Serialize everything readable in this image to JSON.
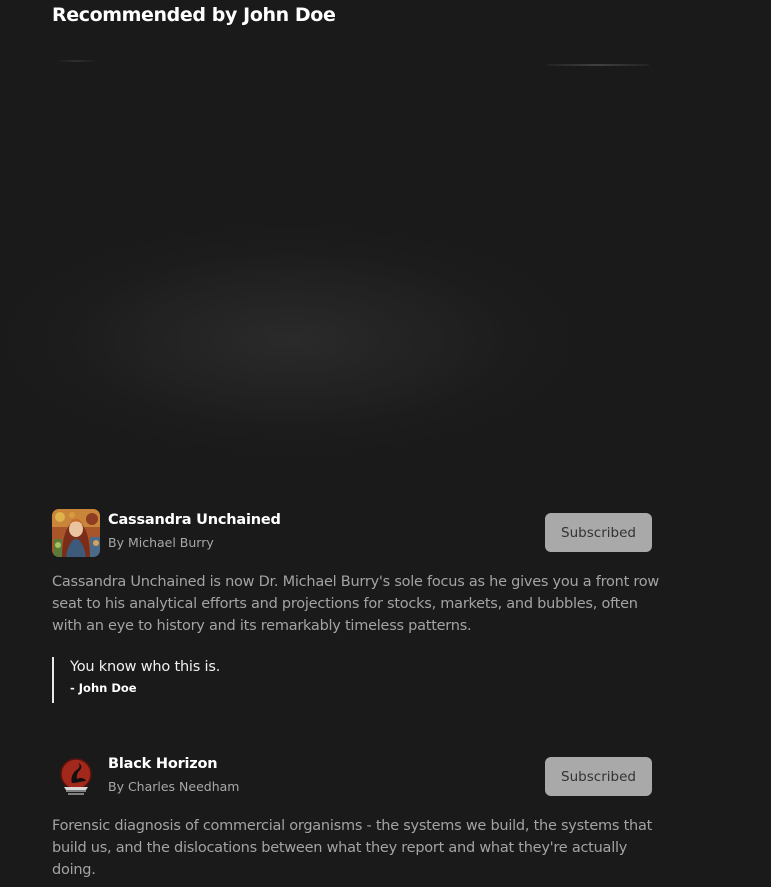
{
  "page": {
    "title": "Recommended by John Doe"
  },
  "recommendations": [
    {
      "title": "Cassandra Unchained",
      "author": "By Michael Burry",
      "button_label": "Subscribed",
      "description": "Cassandra Unchained is now Dr. Michael Burry's sole focus as he gives you a front row seat to his analytical efforts and projections for stocks, markets, and bubbles, often with an eye to history and its remarkably timeless patterns.",
      "quote": "You know who this is.",
      "quote_author": "- John Doe",
      "logo_icon": "painted-portrait-logo"
    },
    {
      "title": "Black Horizon",
      "author": "By Charles Needham",
      "button_label": "Subscribed",
      "description": "Forensic diagnosis of commercial organisms - the systems we build, the systems that build us, and the dislocations between what they report and what they're actually doing.",
      "logo_icon": "black-swan-logo"
    }
  ]
}
